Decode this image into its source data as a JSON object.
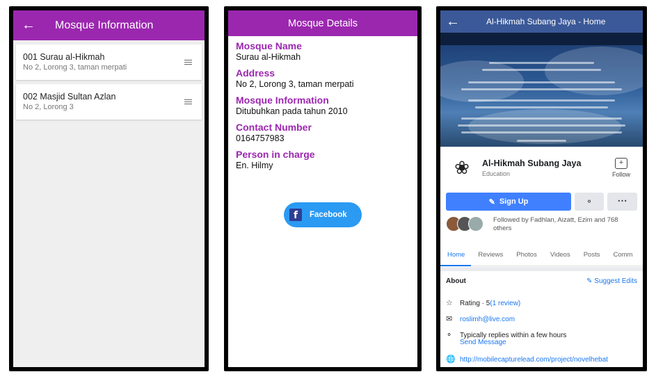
{
  "screen1": {
    "title": "Mosque Information",
    "items": [
      {
        "name": "001 Surau al-Hikmah",
        "address": "No 2, Lorong 3, taman merpati"
      },
      {
        "name": "002 Masjid Sultan Azlan",
        "address": "No 2, Lorong 3"
      }
    ]
  },
  "screen2": {
    "title": "Mosque Details",
    "fields": [
      {
        "label": "Mosque Name",
        "value": "Surau al-Hikmah"
      },
      {
        "label": "Address",
        "value": "No 2, Lorong 3, taman merpati"
      },
      {
        "label": "Mosque Information",
        "value": "Ditubuhkan pada tahun 2010"
      },
      {
        "label": "Contact Number",
        "value": "0164757983"
      },
      {
        "label": "Person in charge",
        "value": "En. Hilmy"
      }
    ],
    "facebook_button": "Facebook"
  },
  "screen3": {
    "title": "Al-Hikmah Subang Jaya - Home",
    "page_name": "Al-Hikmah Subang Jaya",
    "category": "Education",
    "follow_label": "Follow",
    "signup_label": "Sign Up",
    "followers_text": "Followed by Fadhlan, Aizatt, Ezim and 768 others",
    "tabs": [
      "Home",
      "Reviews",
      "Photos",
      "Videos",
      "Posts",
      "Comm"
    ],
    "about_title": "About",
    "suggest_edits": "Suggest Edits",
    "rating_prefix": "Rating · 5",
    "rating_link": "(1 review)",
    "email": "roslimh@live.com",
    "reply_text": "Typically replies within a few hours",
    "send_message": "Send Message",
    "website": "http://mobilecapturelead.com/project/novelhebat"
  }
}
